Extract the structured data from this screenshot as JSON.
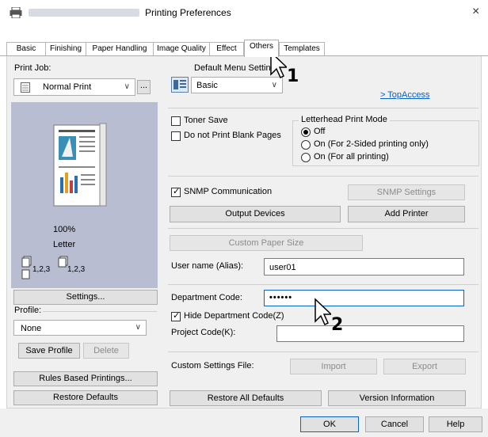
{
  "window": {
    "title": "Printing Preferences",
    "close_glyph": "×"
  },
  "tabs": [
    {
      "label": "Basic"
    },
    {
      "label": "Finishing"
    },
    {
      "label": "Paper Handling"
    },
    {
      "label": "Image Quality"
    },
    {
      "label": "Effect"
    },
    {
      "label": "Others"
    },
    {
      "label": "Templates"
    }
  ],
  "left": {
    "print_job_label": "Print Job:",
    "print_job_value": "Normal Print",
    "ellipsis": "...",
    "zoom": "100%",
    "paper": "Letter",
    "collate1": "1,2,3",
    "collate2": "1,2,3",
    "settings_button": "Settings...",
    "profile_label": "Profile:",
    "profile_value": "None",
    "save_profile_button": "Save Profile",
    "delete_button": "Delete",
    "rules_button": "Rules Based Printings...",
    "restore_defaults_button": "Restore Defaults"
  },
  "right": {
    "default_menu_label": "Default Menu Setting",
    "default_menu_value": "Basic",
    "topaccess_link": "> TopAccess",
    "toner_save": "Toner Save",
    "no_blank": "Do not Print Blank Pages",
    "letterhead_label": "Letterhead Print Mode",
    "lh_off": "Off",
    "lh_2sided": "On (For 2-Sided printing only)",
    "lh_all": "On (For all printing)",
    "snmp_label": "SNMP Communication",
    "snmp_settings_button": "SNMP Settings",
    "output_devices_button": "Output Devices",
    "add_printer_button": "Add Printer",
    "custom_paper_button": "Custom Paper Size",
    "user_name_label": "User name (Alias):",
    "user_name_value": "user01",
    "dept_code_label": "Department Code:",
    "dept_code_value": "••••••",
    "hide_dept_label": "Hide Department Code(Z)",
    "project_code_label": "Project Code(K):",
    "project_code_value": "",
    "custom_settings_label": "Custom Settings File:",
    "import_button": "Import",
    "export_button": "Export",
    "restore_all_button": "Restore All Defaults",
    "version_button": "Version Information"
  },
  "footer": {
    "ok": "OK",
    "cancel": "Cancel",
    "help": "Help"
  },
  "callouts": {
    "one": "1",
    "two": "2"
  },
  "state": {
    "toner_save": false,
    "no_blank": false,
    "letterhead": "Off",
    "snmp": true,
    "hide_dept": true
  }
}
